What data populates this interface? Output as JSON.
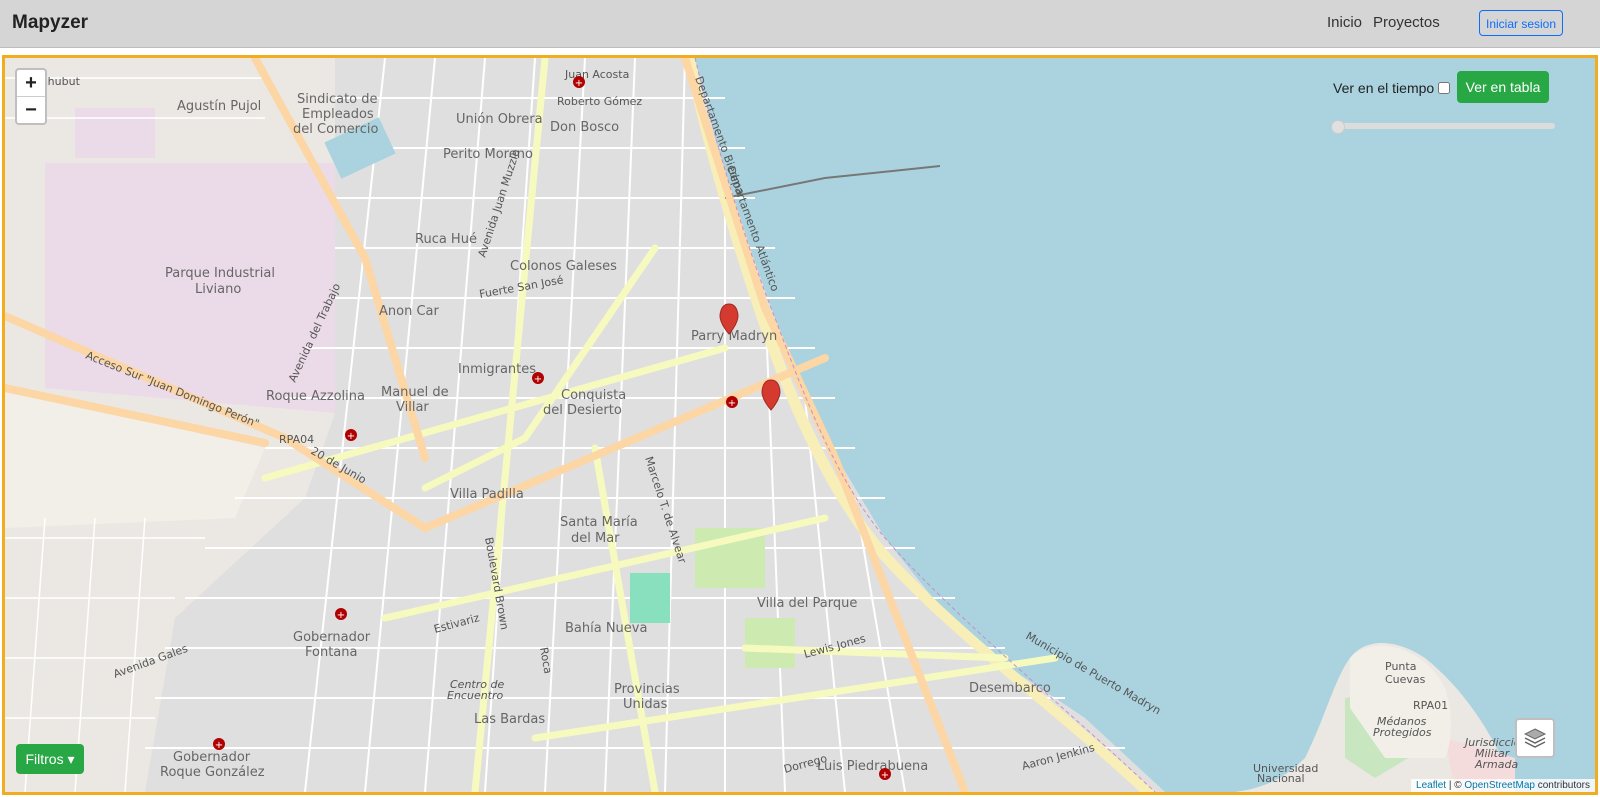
{
  "navbar": {
    "brand": "Mapyzer",
    "links": {
      "home": "Inicio",
      "projects": "Proyectos"
    },
    "login_label": "Iniciar sesion"
  },
  "map_controls": {
    "zoom_in": "+",
    "zoom_out": "−",
    "time_toggle_label": "Ver en el tiempo",
    "table_button_label": "Ver en tabla",
    "filters_label": "Filtros",
    "filters_caret": "▾"
  },
  "attribution": {
    "leaflet": "Leaflet",
    "separator": " | © ",
    "osm": "OpenStreetMap",
    "contributors": " contributors"
  },
  "map_labels": {
    "l1": "Chubut",
    "l2": "Agustín Pujol",
    "l3": "Sindicato de",
    "l4": "Empleados",
    "l5": "del Comercio",
    "l6": "Unión Obrera",
    "l7": "Perito Moreno",
    "l8": "Don Bosco",
    "l9": "Ruca Hué",
    "l10": "Colonos Galeses",
    "l11": "Parque Industrial",
    "l12": "Liviano",
    "l13": "Anon Car",
    "l14": "Inmigrantes",
    "l15": "Parry Madryn",
    "l16": "Roque Azzolina",
    "l17": "Manuel de",
    "l18": "Villar",
    "l19": "Conquista",
    "l20": "del Desierto",
    "l21": "Villa Padilla",
    "l22": "Santa María",
    "l23": "del Mar",
    "l24": "Villa del Parque",
    "l25": "Bahía Nueva",
    "l26": "Gobernador",
    "l27": "Fontana",
    "l28": "Provincias",
    "l29": "Unidas",
    "l30": "Las Bardas",
    "l31": "Desembarco",
    "l32": "Punta",
    "l33": "Cuevas",
    "l34": "Gobernador",
    "l35": "Roque González",
    "l36": "Luis Piedrabuena",
    "l37": "Juan Acosta",
    "l38": "Roberto Gómez",
    "l39": "RPA04",
    "l40": "RPA01",
    "l41": "Médanos",
    "l42": "Protegidos",
    "l43": "Jurisdicción",
    "l44": "Militar",
    "l45": "Armada",
    "l46": "Centro de",
    "l47": "Encuentro",
    "l48": "Avenida del Trabajo",
    "l49": "Acceso Sur \"Juan Domingo Perón\"",
    "l50": "20 de Junio",
    "l51": "Estivariz",
    "l52": "Boulevard Brown",
    "l53": "Roca",
    "l54": "Fuerte San José",
    "l55": "Avenida Juan Muzzio",
    "l56": "Marcelo T. de Alvear",
    "l57": "Lewis Jones",
    "l58": "Avenida Gales",
    "l59": "Municipio de Puerto Madryn",
    "l60": "Departamento Atlántico",
    "l61": "Dorrego",
    "l62": "Aaron Jenkins",
    "l63": "Universidad",
    "l64": "Nacional",
    "l65": "Departamento Biedma"
  },
  "colors": {
    "sea": "#aad3df",
    "land": "#ebe8e3",
    "industrial": "#ebdbe8",
    "primary_road": "#fcd6a4",
    "secondary_road": "#f7fabf",
    "marker": "#d43a2f",
    "accent_green": "#28a745",
    "map_border": "#f0ad1f"
  },
  "icons": {
    "layers": "layers-icon",
    "marker": "map-marker-icon",
    "hospital": "hospital-icon"
  }
}
